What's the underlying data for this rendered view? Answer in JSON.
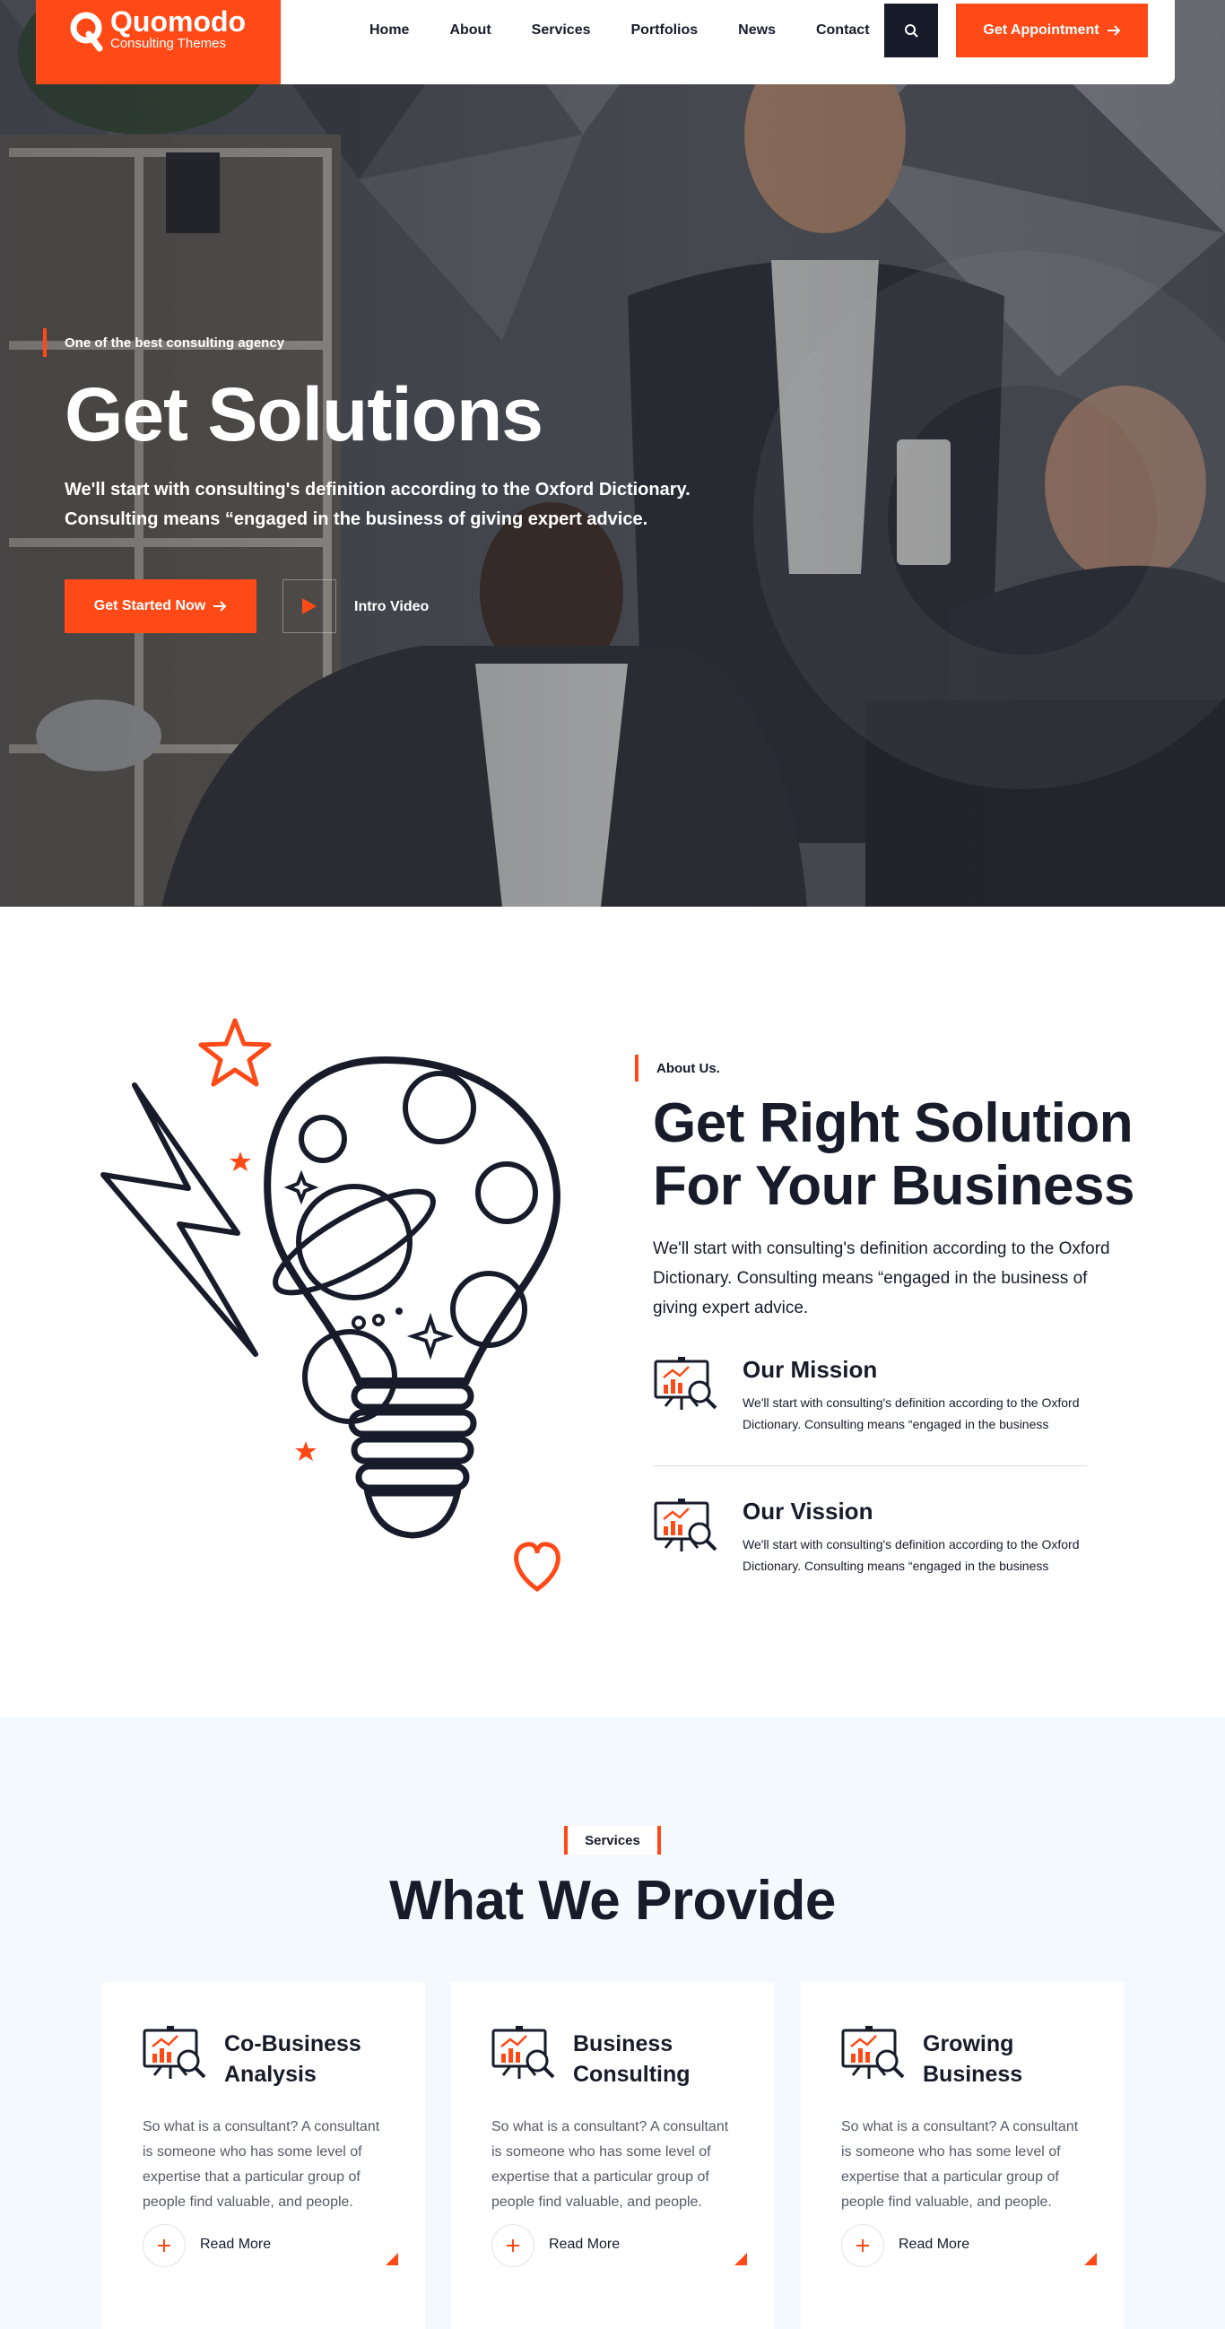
{
  "brand": {
    "name": "Quomodo",
    "tagline": "Consulting Themes",
    "accent": "#ff4a17",
    "dark": "#171b2a"
  },
  "nav": {
    "items": [
      "Home",
      "About",
      "Services",
      "Portfolios",
      "News",
      "Contact"
    ],
    "search_icon": "search-icon",
    "cta_label": "Get Appointment"
  },
  "hero": {
    "kicker": "One of the best consulting agency",
    "title": "Get Solutions",
    "description": "We'll start with consulting's definition according to the Oxford Dictionary. Consulting means “engaged in the business of giving expert advice.",
    "cta_label": "Get Started Now",
    "video_label": "Intro Video"
  },
  "about": {
    "kicker": "About Us.",
    "title": "Get Right Solution For Your Business",
    "description": "We'll start with consulting's definition according to the Oxford Dictionary. Consulting means “engaged in the business of giving expert advice.",
    "features": [
      {
        "title": "Our Mission",
        "description": "We'll start with consulting's definition according to the Oxford Dictionary. Consulting means “engaged in the business"
      },
      {
        "title": "Our Vission",
        "description": "We'll start with consulting's definition according to the Oxford Dictionary. Consulting means “engaged in the business"
      }
    ]
  },
  "services": {
    "kicker": "Services",
    "title": "What We Provide",
    "cards": [
      {
        "title": "Co-Business Analysis",
        "description": "So what is a consultant? A consultant is someone who has some level of expertise that a particular group of people find valuable, and people.",
        "link": "Read More"
      },
      {
        "title": "Business Consulting",
        "description": "So what is a consultant? A consultant is someone who has some level of expertise that a particular group of people find valuable, and people.",
        "link": "Read More"
      },
      {
        "title": "Growing Business",
        "description": "So what is a consultant? A consultant is someone who has some level of expertise that a particular group of people find valuable, and people.",
        "link": "Read More"
      }
    ]
  }
}
